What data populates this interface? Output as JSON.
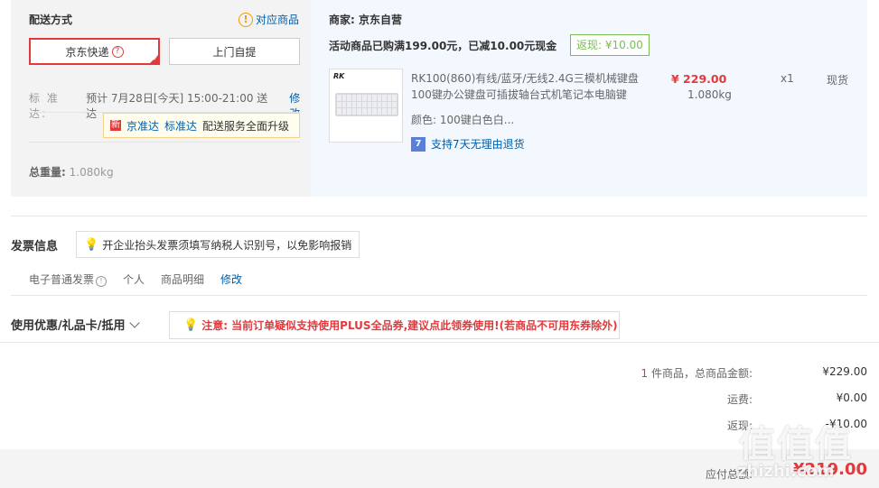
{
  "shipping": {
    "title": "配送方式",
    "match_link": "对应商品",
    "match_icon": "!",
    "option_jd": "京东快递",
    "option_self": "上门自提",
    "std_label": "标 准 达:",
    "std_text": "预计 7月28日[今天] 15:00-21:00 送达",
    "modify": "修改",
    "tip_tag": "新",
    "tip_link1": "京准达",
    "tip_link2": "标准达",
    "tip_text": "配送服务全面升级",
    "weight_label": "总重量:",
    "weight_value": "1.080kg"
  },
  "order": {
    "merchant": "商家: 京东自营",
    "promo": "活动商品已购满199.00元，已减10.00元现金",
    "rebate": "返现: ¥10.00",
    "thumb_logo": "RK",
    "product_title": "RK100(860)有线/蓝牙/无线2.4G三模机械键盘 100键办公键盘可插拔轴台式机笔记本电脑键",
    "price": "¥ 229.00",
    "weight": "1.080kg",
    "qty": "x1",
    "stock": "现货",
    "color": "颜色: 100键白色白...",
    "return_icon": "7",
    "return_text": "支持7天无理由退货"
  },
  "invoice": {
    "title": "发票信息",
    "tip": "开企业抬头发票须填写纳税人识别号，以免影响报销",
    "type": "电子普通发票",
    "owner": "个人",
    "content": "商品明细",
    "modify": "修改"
  },
  "coupon": {
    "title": "使用优惠/礼品卡/抵用",
    "tip": "注意: 当前订单疑似支持使用PLUS全品券,建议点此领券使用!(若商品不可用东券除外)"
  },
  "summary": {
    "count": "1",
    "count_text": "件商品，总商品金额:",
    "goods_value": "¥229.00",
    "freight_label": "运费:",
    "freight_value": "¥0.00",
    "rebate_label": "返现:",
    "rebate_value": "-¥10.00",
    "pay_label": "应付总额:",
    "pay_value": "¥219.00"
  },
  "watermark": {
    "big": "值值值",
    "small": "zhizhi.com"
  },
  "colors": {
    "accent": "#e4393c",
    "link": "#005ea7",
    "rebate": "#7abd54"
  }
}
